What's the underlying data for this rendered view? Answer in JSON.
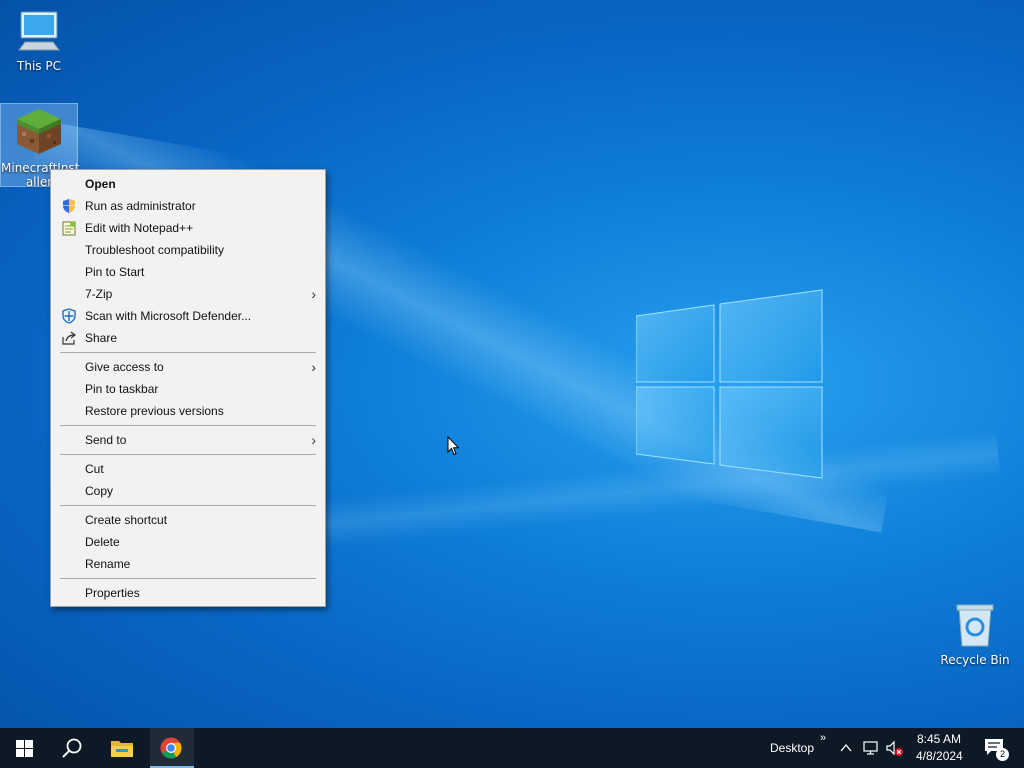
{
  "desktop": {
    "icons": [
      {
        "label": "This PC"
      },
      {
        "label": "MinecraftInst aller"
      },
      {
        "label": "Recycle Bin"
      }
    ]
  },
  "context_menu": {
    "items": [
      {
        "label": "Open",
        "bold": true
      },
      {
        "label": "Run as administrator",
        "icon": "shield-icon"
      },
      {
        "label": "Edit with Notepad++",
        "icon": "notepad-plus-plus-icon"
      },
      {
        "label": "Troubleshoot compatibility"
      },
      {
        "label": "Pin to Start"
      },
      {
        "label": "7-Zip",
        "submenu": true
      },
      {
        "label": "Scan with Microsoft Defender...",
        "icon": "defender-icon"
      },
      {
        "label": "Share",
        "icon": "share-icon"
      },
      {
        "label": "Give access to",
        "submenu": true
      },
      {
        "label": "Pin to taskbar"
      },
      {
        "label": "Restore previous versions"
      },
      {
        "label": "Send to",
        "submenu": true
      },
      {
        "label": "Cut"
      },
      {
        "label": "Copy"
      },
      {
        "label": "Create shortcut"
      },
      {
        "label": "Delete"
      },
      {
        "label": "Rename"
      },
      {
        "label": "Properties"
      }
    ]
  },
  "taskbar": {
    "toolbar_label": "Desktop",
    "time": "8:45 AM",
    "date": "4/8/2024",
    "notification_count": "2"
  },
  "colors": {
    "accent": "#0078d7",
    "taskbar_bg": "#0d1a26",
    "menu_bg": "#f2f2f2"
  }
}
